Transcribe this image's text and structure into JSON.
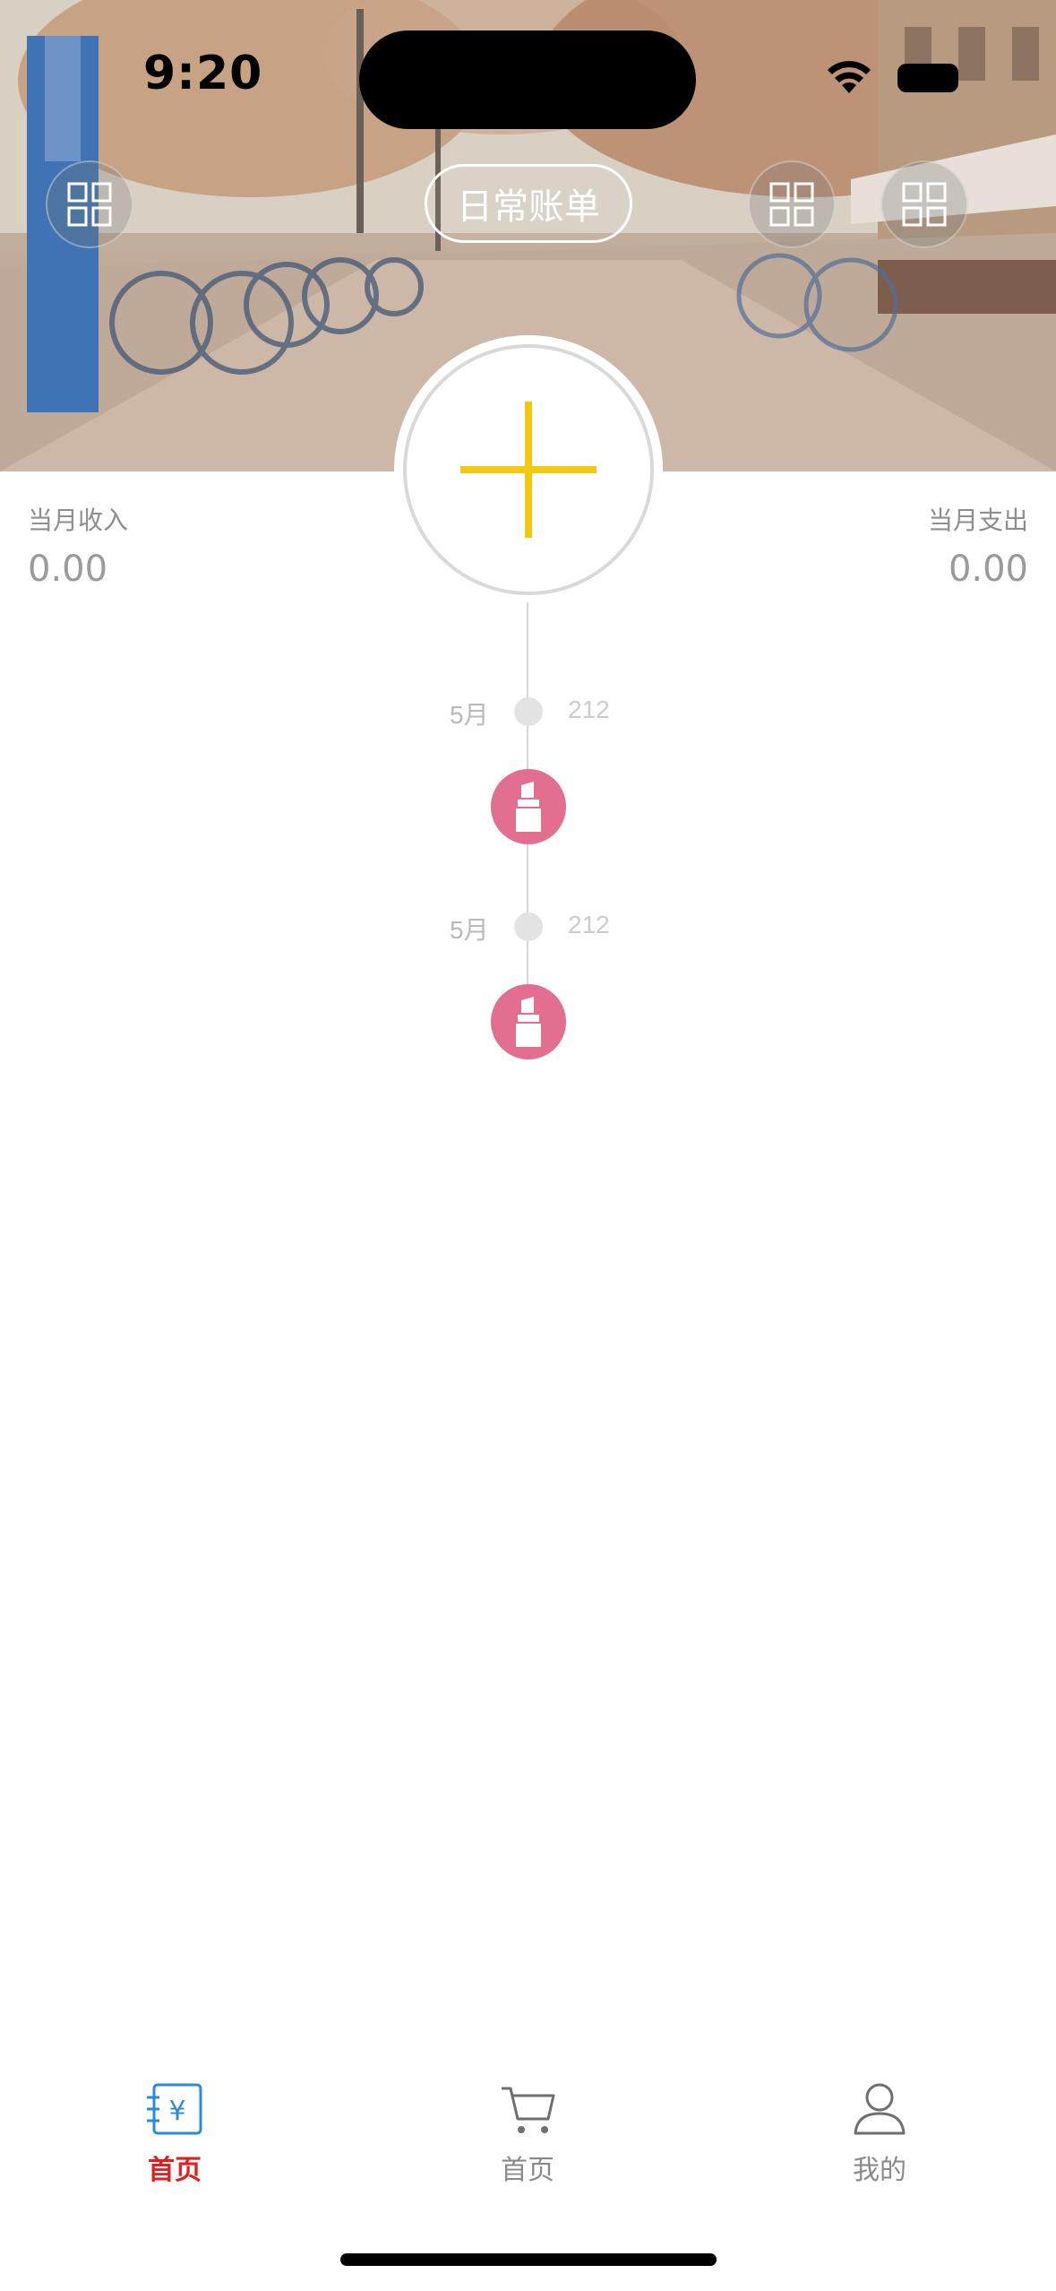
{
  "status_bar": {
    "time": "9:20"
  },
  "header": {
    "title": "日常账单",
    "left_button_icon": "grid-icon",
    "right_button_icons": [
      "grid-icon",
      "grid-icon"
    ]
  },
  "add_button": {
    "icon": "plus-icon",
    "color": "#F2C811"
  },
  "summary": {
    "income_label": "当月收入",
    "income_value": "0.00",
    "expense_label": "当月支出",
    "expense_value": "0.00"
  },
  "timeline": [
    {
      "month": "5月",
      "day": "212",
      "category_icon": "lipstick-icon",
      "category_color": "#E26F8F"
    },
    {
      "month": "5月",
      "day": "212",
      "category_icon": "lipstick-icon",
      "category_color": "#E26F8F"
    }
  ],
  "tabbar": {
    "active_color": "#E02020",
    "tabs": [
      {
        "label": "首页",
        "icon": "bill-yuan-icon",
        "active": true
      },
      {
        "label": "首页",
        "icon": "cart-icon",
        "active": false
      },
      {
        "label": "我的",
        "icon": "person-icon",
        "active": false
      }
    ]
  }
}
